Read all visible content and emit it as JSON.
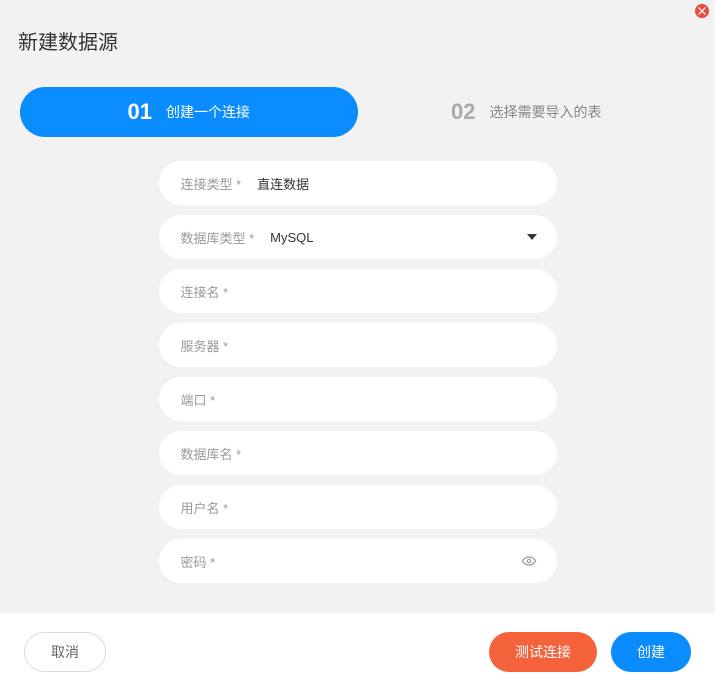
{
  "title": "新建数据源",
  "close": {
    "name": "close"
  },
  "steps": [
    {
      "num": "01",
      "label": "创建一个连接",
      "active": true
    },
    {
      "num": "02",
      "label": "选择需要导入的表",
      "active": false
    }
  ],
  "form": {
    "conn_type": {
      "label": "连接类型 *",
      "value": "直连数据"
    },
    "db_type": {
      "label": "数据库类型 *",
      "value": "MySQL"
    },
    "conn_name": {
      "label": "连接名 *",
      "value": ""
    },
    "server": {
      "label": "服务器 *",
      "value": ""
    },
    "port": {
      "label": "端口 *",
      "value": ""
    },
    "db_name": {
      "label": "数据库名 *",
      "value": ""
    },
    "username": {
      "label": "用户名 *",
      "value": ""
    },
    "password": {
      "label": "密码 *",
      "value": ""
    }
  },
  "buttons": {
    "cancel": "取消",
    "test": "测试连接",
    "create": "创建"
  }
}
